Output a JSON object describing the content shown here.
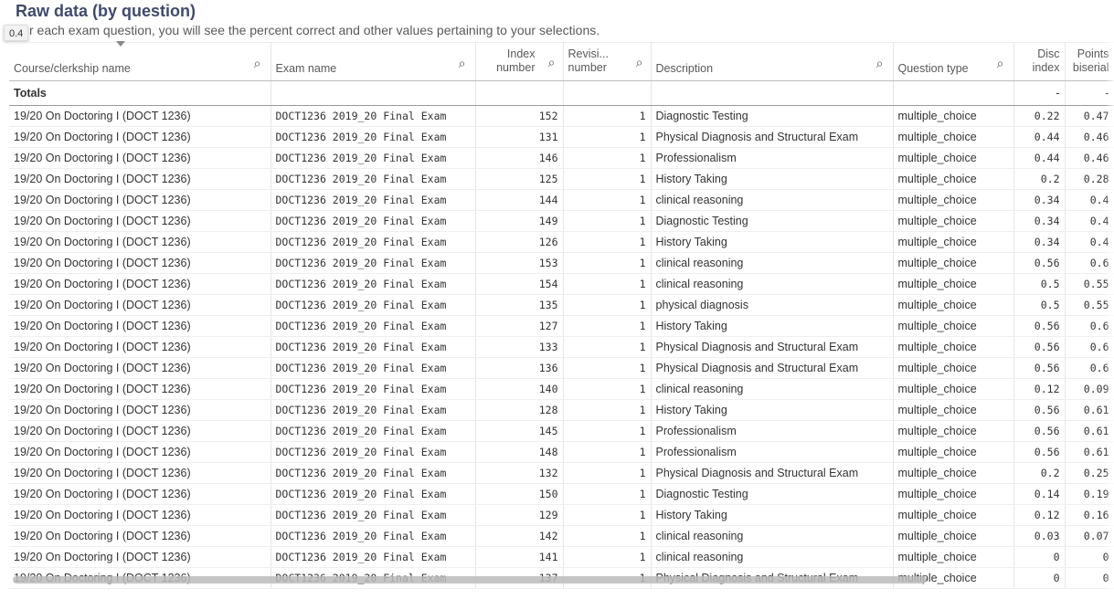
{
  "title": "Raw data (by question)",
  "subtitle": "For each exam question, you will see the percent correct and other values pertaining to your selections.",
  "subtitle_visible": "r each exam question, you will see the percent correct and other values pertaining to your selections.",
  "tooltip": "0.4",
  "columns": [
    "Course/clerkship name",
    "Exam name",
    "Index number",
    "Revisi... number",
    "Description",
    "Question type",
    "Disc index",
    "Points biserial"
  ],
  "col_lines": [
    [
      "Index",
      "number"
    ],
    [
      "Revisi...",
      "number"
    ],
    [
      "Disc",
      "index"
    ],
    [
      "Points",
      "biserial"
    ]
  ],
  "totals": {
    "label": "Totals",
    "disc": "-",
    "pb": "-"
  },
  "course": "19/20 On Doctoring I (DOCT 1236)",
  "exam": "DOCT1236 2019_20 Final Exam",
  "qtype": "multiple_choice",
  "rows": [
    [
      "152",
      "1",
      "Diagnostic Testing",
      "0.22",
      "0.47"
    ],
    [
      "131",
      "1",
      "Physical Diagnosis and Structural Exam",
      "0.44",
      "0.46"
    ],
    [
      "146",
      "1",
      "Professionalism",
      "0.44",
      "0.46"
    ],
    [
      "125",
      "1",
      "History Taking",
      "0.2",
      "0.28"
    ],
    [
      "144",
      "1",
      "clinical reasoning",
      "0.34",
      "0.4"
    ],
    [
      "149",
      "1",
      "Diagnostic Testing",
      "0.34",
      "0.4"
    ],
    [
      "126",
      "1",
      "History Taking",
      "0.34",
      "0.4"
    ],
    [
      "153",
      "1",
      "clinical reasoning",
      "0.56",
      "0.6"
    ],
    [
      "154",
      "1",
      "clinical reasoning",
      "0.5",
      "0.55"
    ],
    [
      "135",
      "1",
      "physical diagnosis",
      "0.5",
      "0.55"
    ],
    [
      "127",
      "1",
      "History Taking",
      "0.56",
      "0.6"
    ],
    [
      "133",
      "1",
      "Physical Diagnosis and Structural Exam",
      "0.56",
      "0.6"
    ],
    [
      "136",
      "1",
      "Physical Diagnosis and Structural Exam",
      "0.56",
      "0.6"
    ],
    [
      "140",
      "1",
      "clinical reasoning",
      "0.12",
      "0.09"
    ],
    [
      "128",
      "1",
      "History Taking",
      "0.56",
      "0.61"
    ],
    [
      "145",
      "1",
      "Professionalism",
      "0.56",
      "0.61"
    ],
    [
      "148",
      "1",
      "Professionalism",
      "0.56",
      "0.61"
    ],
    [
      "132",
      "1",
      "Physical Diagnosis and Structural Exam",
      "0.2",
      "0.25"
    ],
    [
      "150",
      "1",
      "Diagnostic Testing",
      "0.14",
      "0.19"
    ],
    [
      "129",
      "1",
      "History Taking",
      "0.12",
      "0.16"
    ],
    [
      "142",
      "1",
      "clinical reasoning",
      "0.03",
      "0.07"
    ],
    [
      "141",
      "1",
      "clinical reasoning",
      "0",
      "0"
    ],
    [
      "137",
      "1",
      "Physical Diagnosis and Structural Exam",
      "0",
      "0"
    ]
  ]
}
